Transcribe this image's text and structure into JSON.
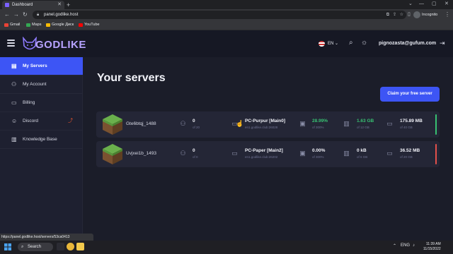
{
  "browser": {
    "tab_title": "Dashboard",
    "url": "panel.godlike.host",
    "profile": "Incognito",
    "bookmarks": [
      "Gmail",
      "Maps",
      "Google Диск",
      "YouTube"
    ]
  },
  "app": {
    "logo_text": "GODLIKE",
    "lang": "EN",
    "user_email": "pignozasta@gufum.com"
  },
  "sidebar": {
    "items": [
      {
        "label": "My Servers",
        "icon": "servers-icon"
      },
      {
        "label": "My Account",
        "icon": "user-icon"
      },
      {
        "label": "Billing",
        "icon": "card-icon"
      },
      {
        "label": "Discord",
        "icon": "discord-icon"
      },
      {
        "label": "Knowledge Base",
        "icon": "book-icon"
      }
    ]
  },
  "main": {
    "title": "Your servers",
    "claim_label": "Claim your free server"
  },
  "servers": [
    {
      "name": "Gte6btqj_1488",
      "players": "0",
      "players_max": "of 20",
      "node": "PC-Purpur [Main0]",
      "address": "en1.godlike.club:26028",
      "cpu": "28.99%",
      "cpu_max": "of 300%",
      "ram": "1.63 GB",
      "ram_max": "of 12 GB",
      "disk": "175.89 MB",
      "disk_max": "of 40 GB",
      "status_color": "#38c172"
    },
    {
      "name": "Uvjxei1b_1493",
      "players": "0",
      "players_max": "of 0",
      "node": "PC-Paper [Main2]",
      "address": "en1.godlike.club:26202",
      "cpu": "0.00%",
      "cpu_max": "of 300%",
      "ram": "0 kB",
      "ram_max": "of 6 GB",
      "disk": "36.52 MB",
      "disk_max": "of 20 GB",
      "status_color": "#e3504b"
    }
  ],
  "status_url": "https://panel.godlike.host/servers/53ca0413",
  "taskbar": {
    "search_label": "Search",
    "lang": "ENG",
    "time": "11:39 AM",
    "date": "11/15/2022"
  },
  "colors": {
    "accent": "#3d55f5",
    "online": "#38c172",
    "offline": "#e3504b"
  }
}
